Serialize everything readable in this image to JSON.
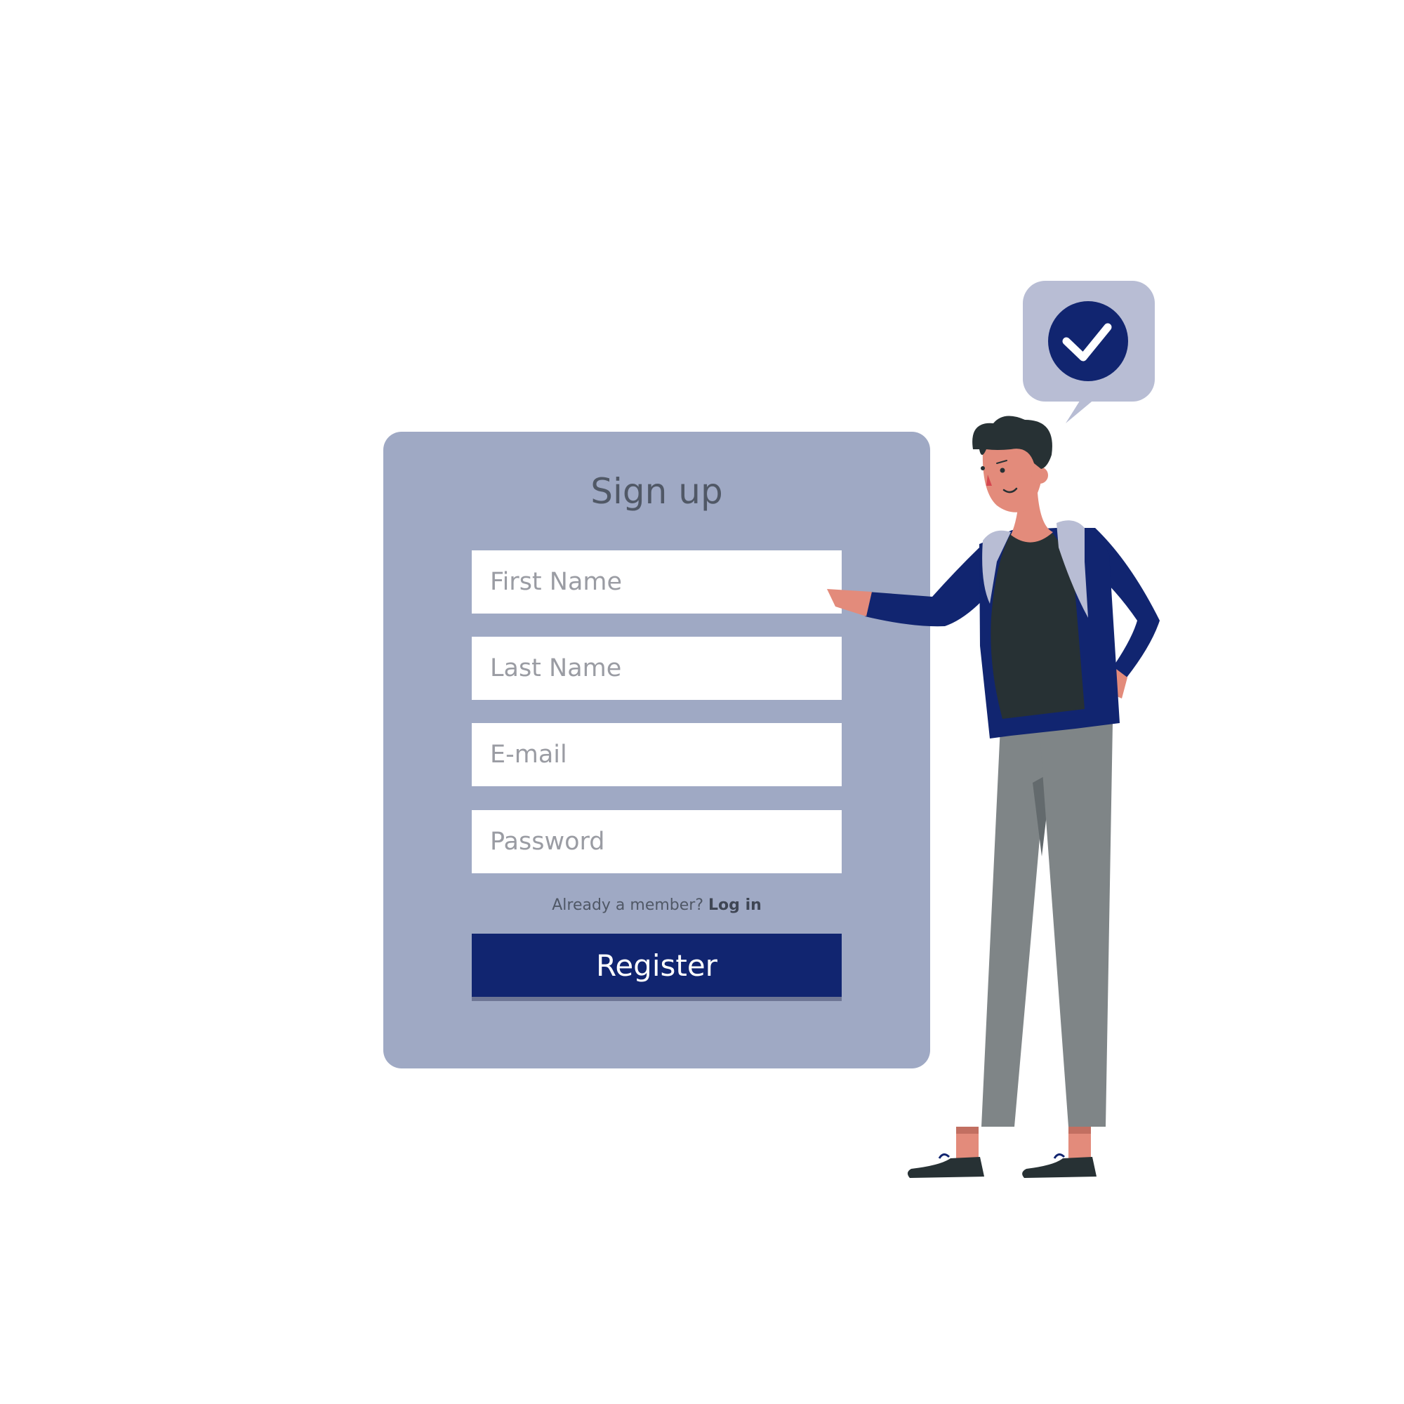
{
  "form": {
    "title": "Sign up",
    "first_name_placeholder": "First Name",
    "last_name_placeholder": "Last Name",
    "email_placeholder": "E-mail",
    "password_placeholder": "Password",
    "member_text": "Already a member?",
    "login_link": "Log in",
    "register_label": "Register"
  },
  "illustration": {
    "bubble_icon": "check-circle-icon"
  },
  "colors": {
    "card_bg": "#9fa9c4",
    "button_bg": "#112570",
    "bubble_bg": "#b8bdd4",
    "jacket": "#112570",
    "pants": "#7f8587"
  }
}
